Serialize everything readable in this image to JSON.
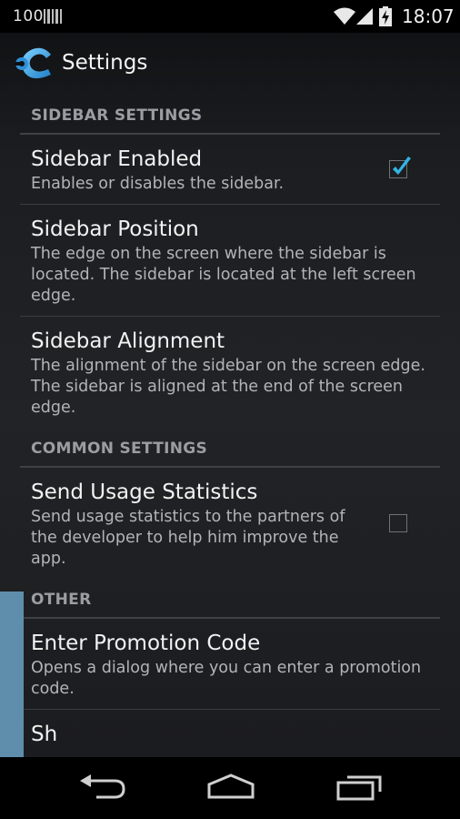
{
  "status_bar": {
    "battery_text": "100",
    "time": "18:07",
    "icons": [
      "barcode-icon",
      "wifi-icon",
      "signal-icon",
      "battery-charging-icon"
    ]
  },
  "action_bar": {
    "title": "Settings",
    "icon": "wrench-app-icon"
  },
  "sections": [
    {
      "header": "SIDEBAR SETTINGS",
      "items": [
        {
          "title": "Sidebar Enabled",
          "summary": "Enables or disables the sidebar.",
          "checkbox": true,
          "checked": true
        },
        {
          "title": "Sidebar Position",
          "summary": "The edge on the screen where the sidebar is located. The sidebar is located at the left screen edge."
        },
        {
          "title": "Sidebar Alignment",
          "summary": "The alignment of the sidebar on the screen edge. The sidebar is aligned at the end of the screen edge."
        }
      ]
    },
    {
      "header": "COMMON SETTINGS",
      "items": [
        {
          "title": "Send Usage Statistics",
          "summary": "Send usage statistics to the partners of the developer to help him improve the app.",
          "checkbox": true,
          "checked": false
        }
      ]
    },
    {
      "header": "OTHER",
      "items": [
        {
          "title": "Enter Promotion Code",
          "summary": "Opens a dialog where you can enter a promotion code."
        },
        {
          "title": "Sh",
          "summary": ""
        }
      ]
    }
  ],
  "colors": {
    "accent": "#33b5e5",
    "section_header": "#9a9ea3",
    "sidebar_edge": "#5e8eac"
  },
  "nav_bar": {
    "icons": [
      "back-icon",
      "home-icon",
      "recent-apps-icon"
    ]
  }
}
